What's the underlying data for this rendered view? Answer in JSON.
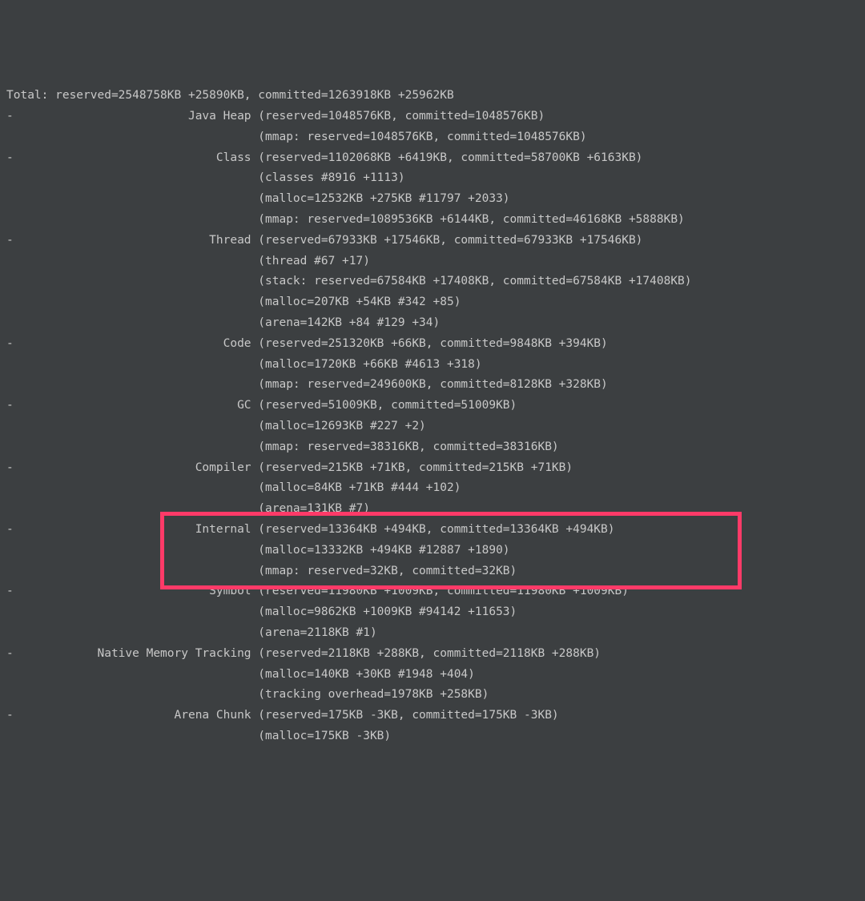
{
  "nmt": {
    "total_line": "Total: reserved=2548758KB +25890KB, committed=1263918KB +25962KB",
    "sections": [
      {
        "name": "Java Heap",
        "main": "(reserved=1048576KB, committed=1048576KB)",
        "details": [
          "(mmap: reserved=1048576KB, committed=1048576KB)"
        ]
      },
      {
        "name": "Class",
        "main": "(reserved=1102068KB +6419KB, committed=58700KB +6163KB)",
        "details": [
          "(classes #8916 +1113)",
          "(malloc=12532KB +275KB #11797 +2033)",
          "(mmap: reserved=1089536KB +6144KB, committed=46168KB +5888KB)"
        ]
      },
      {
        "name": "Thread",
        "main": "(reserved=67933KB +17546KB, committed=67933KB +17546KB)",
        "details": [
          "(thread #67 +17)",
          "(stack: reserved=67584KB +17408KB, committed=67584KB +17408KB)",
          "(malloc=207KB +54KB #342 +85)",
          "(arena=142KB +84 #129 +34)"
        ]
      },
      {
        "name": "Code",
        "main": "(reserved=251320KB +66KB, committed=9848KB +394KB)",
        "details": [
          "(malloc=1720KB +66KB #4613 +318)",
          "(mmap: reserved=249600KB, committed=8128KB +328KB)"
        ]
      },
      {
        "name": "GC",
        "main": "(reserved=51009KB, committed=51009KB)",
        "details": [
          "(malloc=12693KB #227 +2)",
          "(mmap: reserved=38316KB, committed=38316KB)"
        ]
      },
      {
        "name": "Compiler",
        "main": "(reserved=215KB +71KB, committed=215KB +71KB)",
        "details": [
          "(malloc=84KB +71KB #444 +102)",
          "(arena=131KB #7)"
        ]
      },
      {
        "name": "Internal",
        "main": "(reserved=13364KB +494KB, committed=13364KB +494KB)",
        "details": [
          "(malloc=13332KB +494KB #12887 +1890)",
          "(mmap: reserved=32KB, committed=32KB)"
        ],
        "highlight": true
      },
      {
        "name": "Symbol",
        "main": "(reserved=11980KB +1009KB, committed=11980KB +1009KB)",
        "details": [
          "(malloc=9862KB +1009KB #94142 +11653)",
          "(arena=2118KB #1)"
        ]
      },
      {
        "name": "Native Memory Tracking",
        "main": "(reserved=2118KB +288KB, committed=2118KB +288KB)",
        "details": [
          "(malloc=140KB +30KB #1948 +404)",
          "(tracking overhead=1978KB +258KB)"
        ]
      },
      {
        "name": "Arena Chunk",
        "main": "(reserved=175KB -3KB, committed=175KB -3KB)",
        "details": [
          "(malloc=175KB -3KB)"
        ]
      }
    ],
    "label_col_width": 35
  }
}
